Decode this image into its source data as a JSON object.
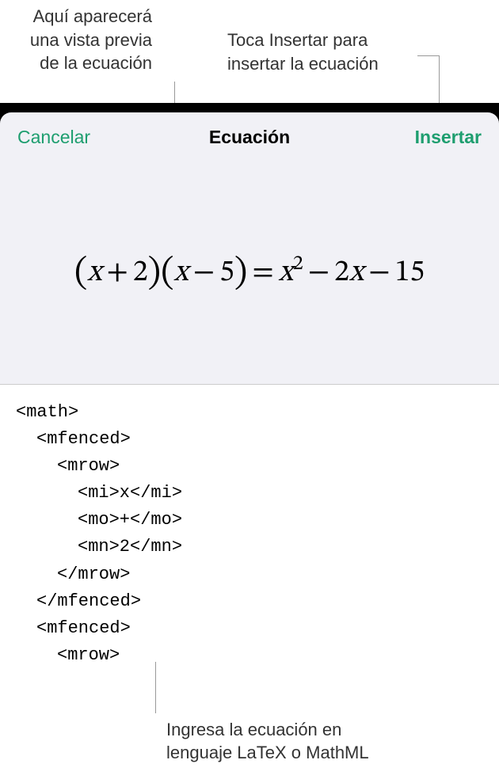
{
  "annotations": {
    "preview": {
      "line1": "Aquí aparecerá",
      "line2": "una vista previa",
      "line3": "de la ecuación"
    },
    "insert": {
      "line1": "Toca Insertar para",
      "line2": "insertar la ecuación"
    },
    "input": {
      "line1": "Ingresa la ecuación en",
      "line2": "lenguaje LaTeX o MathML"
    }
  },
  "modal": {
    "cancel_label": "Cancelar",
    "title": "Ecuación",
    "insert_label": "Insertar"
  },
  "equation": {
    "rendered": "(x + 2)(x − 5) = x² − 2x − 15"
  },
  "mathml_input": {
    "l0": "<math>",
    "l1": "<mfenced>",
    "l2": "<mrow>",
    "l3": "<mi>x</mi>",
    "l4": "<mo>+</mo>",
    "l5": "<mn>2</mn>",
    "l6": "</mrow>",
    "l7": "</mfenced>",
    "l8": "<mfenced>",
    "l9": "<mrow>"
  },
  "colors": {
    "accent": "#1e9e6f"
  }
}
